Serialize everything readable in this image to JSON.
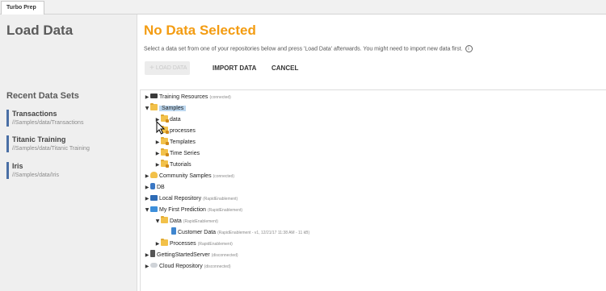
{
  "tab": {
    "label": "Turbo Prep"
  },
  "sidebar": {
    "title": "Load Data",
    "recent_title": "Recent Data Sets",
    "recent": [
      {
        "name": "Transactions",
        "path": "//Samples/data/Transactions"
      },
      {
        "name": "Titanic Training",
        "path": "//Samples/data/Titanic Training"
      },
      {
        "name": "Iris",
        "path": "//Samples/data/Iris"
      }
    ]
  },
  "main": {
    "heading": "No Data Selected",
    "description": "Select a data set from one of your repositories below and press 'Load Data' afterwards.  You might need to import new data first.",
    "info_icon": "i",
    "buttons": {
      "load": "LOAD DATA",
      "import": "IMPORT DATA",
      "cancel": "CANCEL"
    }
  },
  "tree": [
    {
      "arrow": "▶",
      "icon": "train",
      "label": "Training Resources",
      "sub": "(connected)"
    },
    {
      "arrow": "▼",
      "icon": "folder",
      "label": "Samples",
      "sub": "",
      "selected": true
    },
    {
      "arrow": "▶",
      "icon": "folder-lock",
      "label": "data",
      "sub": ""
    },
    {
      "arrow": "",
      "icon": "folder-lock",
      "label": "processes",
      "sub": ""
    },
    {
      "arrow": "▶",
      "icon": "folder-lock",
      "label": "Templates",
      "sub": ""
    },
    {
      "arrow": "▶",
      "icon": "folder-lock",
      "label": "Time Series",
      "sub": ""
    },
    {
      "arrow": "▶",
      "icon": "folder-lock",
      "label": "Tutorials",
      "sub": ""
    },
    {
      "arrow": "▶",
      "icon": "community",
      "label": "Community Samples",
      "sub": "(connected)"
    },
    {
      "arrow": "▶",
      "icon": "db",
      "label": "DB",
      "sub": ""
    },
    {
      "arrow": "▶",
      "icon": "monitor",
      "label": "Local Repository",
      "sub": "(RapidEnablement)"
    },
    {
      "arrow": "▼",
      "icon": "monitor-blue",
      "label": "My First Prediction",
      "sub": "(RapidEnablement)"
    },
    {
      "arrow": "▼",
      "icon": "folder",
      "label": "Data",
      "sub": "(RapidEnablement)"
    },
    {
      "arrow": "",
      "icon": "datafile",
      "label": "Customer Data",
      "sub": "(RapidEnablement - v1, 12/21/17 11:38 AM - 11 kB)"
    },
    {
      "arrow": "▶",
      "icon": "folder",
      "label": "Processes",
      "sub": "(RapidEnablement)"
    },
    {
      "arrow": "▶",
      "icon": "server",
      "label": "GettingStartedServer",
      "sub": "(disconnected)"
    },
    {
      "arrow": "▶",
      "icon": "cloud",
      "label": "Cloud Repository",
      "sub": "(disconnected)"
    }
  ],
  "colors": {
    "heading": "#f39c12",
    "selection": "#bcd7ef",
    "recent_bar": "#4a6fa5"
  }
}
